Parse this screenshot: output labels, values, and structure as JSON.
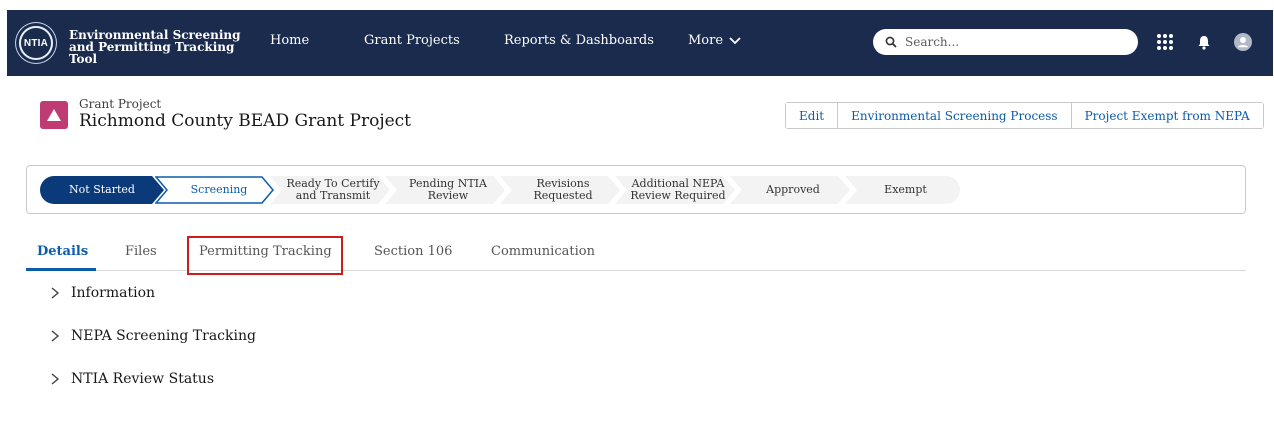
{
  "header": {
    "logo_text": "NTIA",
    "app_name": "Environmental Screening and Permitting Tracking Tool",
    "nav": {
      "home": "Home",
      "grant_projects": "Grant Projects",
      "reports": "Reports & Dashboards",
      "more": "More"
    },
    "search_placeholder": "Search...",
    "bg_color": "#1a2b4e"
  },
  "record": {
    "type": "Grant Project",
    "title": "Richmond County BEAD Grant Project",
    "icon_color": "#c03b73",
    "actions": {
      "edit": "Edit",
      "env_screening": "Environmental Screening Process",
      "exempt": "Project Exempt from NEPA"
    }
  },
  "path": {
    "steps": [
      {
        "label": "Not Started",
        "state": "complete"
      },
      {
        "label": "Screening",
        "state": "current"
      },
      {
        "label": "Ready To Certify\nand Transmit",
        "state": "incomplete"
      },
      {
        "label": "Pending NTIA\nReview",
        "state": "incomplete"
      },
      {
        "label": "Revisions\nRequested",
        "state": "incomplete"
      },
      {
        "label": "Additional NEPA\nReview Required",
        "state": "incomplete"
      },
      {
        "label": "Approved",
        "state": "incomplete"
      },
      {
        "label": "Exempt",
        "state": "incomplete"
      }
    ],
    "complete_color": "#0b3a7a",
    "current_border_color": "#0b5cab",
    "incomplete_color": "#f3f3f3"
  },
  "tabs": {
    "details": "Details",
    "files": "Files",
    "permitting": "Permitting Tracking",
    "section106": "Section 106",
    "communication": "Communication",
    "active": "details",
    "highlight_color": "#c81e1e"
  },
  "sections": {
    "information": "Information",
    "nepa": "NEPA Screening Tracking",
    "ntia_review": "NTIA Review Status"
  }
}
